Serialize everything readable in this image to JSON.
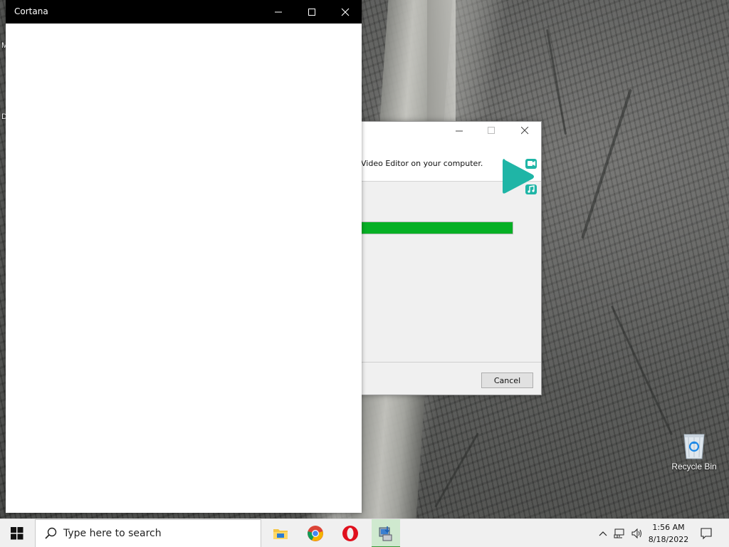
{
  "cortana_window": {
    "title": "Cortana"
  },
  "installer_window": {
    "header_text": "Video Editor on your computer.",
    "progress_percent": 100,
    "cancel_label": "Cancel"
  },
  "desktop": {
    "edge_labels": [
      "M",
      "D"
    ],
    "recycle_bin_label": "Recycle Bin"
  },
  "taskbar": {
    "search_placeholder": "Type here to search",
    "pinned_apps": [
      {
        "name": "file-explorer-icon"
      },
      {
        "name": "chrome-icon"
      },
      {
        "name": "opera-icon"
      },
      {
        "name": "installer-icon"
      }
    ],
    "clock_time": "1:56 AM",
    "clock_date": "8/18/2022"
  },
  "colors": {
    "progress_green": "#06b025",
    "logo_teal": "#1fb5a6"
  }
}
